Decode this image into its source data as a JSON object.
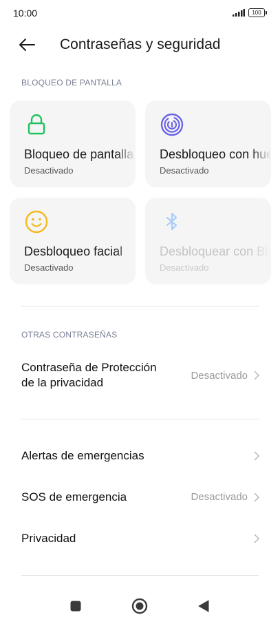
{
  "status": {
    "time": "10:00",
    "battery": "100"
  },
  "header": {
    "title": "Contraseñas y seguridad"
  },
  "sections": {
    "screen_lock": "BLOQUEO DE PANTALLA",
    "other_passwords": "OTRAS CONTRASEÑAS"
  },
  "cards": [
    {
      "title": "Bloqueo de pantalla",
      "status": "Desactivado",
      "icon": "lock-icon",
      "color": "#22c15e"
    },
    {
      "title": "Desbloqueo con huella",
      "status": "Desactivado",
      "icon": "fingerprint-icon",
      "color": "#6b63e8"
    },
    {
      "title": "Desbloqueo facial",
      "status": "Desactivado",
      "icon": "face-icon",
      "color": "#f4b820"
    },
    {
      "title": "Desbloquear con Bluetooth",
      "status": "Desactivado",
      "icon": "bluetooth-icon",
      "color": "#a9cdf5"
    }
  ],
  "rows": {
    "privacy_password": {
      "label_line1": "Contraseña de Protección",
      "label_line2": "de la privacidad",
      "value": "Desactivado"
    },
    "emergency_alerts": {
      "label": "Alertas de emergencias"
    },
    "sos": {
      "label": "SOS de emergencia",
      "value": "Desactivado"
    },
    "privacy": {
      "label": "Privacidad"
    }
  },
  "navbar": {
    "icons": [
      "recents-icon",
      "home-icon",
      "back-icon"
    ]
  }
}
